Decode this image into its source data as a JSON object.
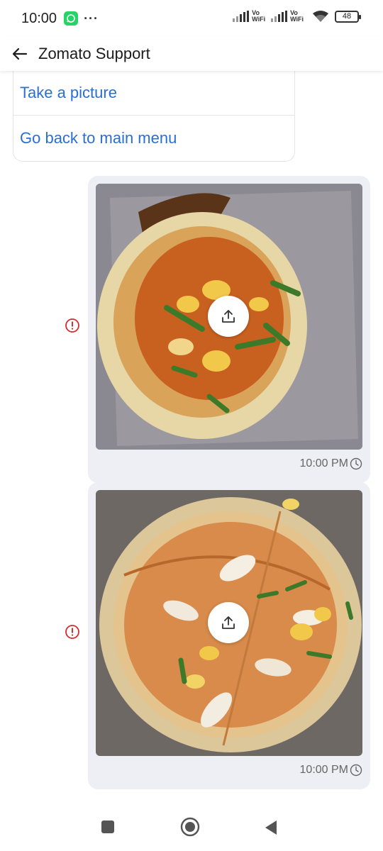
{
  "status_bar": {
    "time": "10:00",
    "network_label": "Vo WiFi",
    "battery": "48"
  },
  "header": {
    "title": "Zomato Support"
  },
  "menu_options": [
    {
      "label": "Take a picture"
    },
    {
      "label": "Go back to main menu"
    }
  ],
  "messages": [
    {
      "type": "image",
      "description_icon": "upload-icon",
      "timestamp": "10:00 PM",
      "status": "pending",
      "error": true
    },
    {
      "type": "image",
      "description_icon": "upload-icon",
      "timestamp": "10:00 PM",
      "status": "pending",
      "error": true
    }
  ],
  "colors": {
    "link": "#2a6fd1",
    "bubble": "#eeeff4",
    "error": "#d32f2f",
    "whatsapp": "#25d366"
  }
}
